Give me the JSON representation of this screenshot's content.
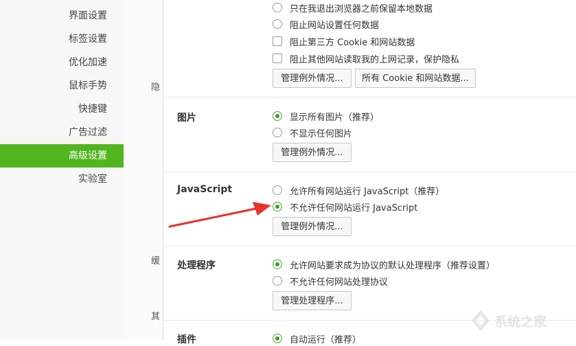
{
  "sidebar": {
    "items": [
      {
        "label": "界面设置"
      },
      {
        "label": "标签设置"
      },
      {
        "label": "优化加速"
      },
      {
        "label": "鼠标手势"
      },
      {
        "label": "快捷键"
      },
      {
        "label": "广告过滤"
      },
      {
        "label": "高级设置",
        "active": true
      },
      {
        "label": "实验室"
      }
    ]
  },
  "middle": {
    "cut_labels": [
      "隐",
      "缓",
      "其"
    ]
  },
  "privacy": {
    "options": [
      {
        "label": "只在我退出浏览器之前保留本地数据",
        "type": "radio",
        "checked": false
      },
      {
        "label": "阻止网站设置任何数据",
        "type": "radio",
        "checked": false
      },
      {
        "label": "阻止第三方 Cookie 和网站数据",
        "type": "checkbox",
        "checked": false
      },
      {
        "label": "阻止其他网站读取我的上网记录，保护隐私",
        "type": "checkbox",
        "checked": false
      }
    ],
    "buttons": [
      "管理例外情况...",
      "所有 Cookie 和网站数据..."
    ]
  },
  "images": {
    "title": "图片",
    "options": [
      {
        "label": "显示所有图片（推荐）",
        "checked": true
      },
      {
        "label": "不显示任何图片",
        "checked": false
      }
    ],
    "button": "管理例外情况..."
  },
  "javascript": {
    "title": "JavaScript",
    "options": [
      {
        "label": "允许所有网站运行 JavaScript（推荐）",
        "checked": false
      },
      {
        "label": "不允许任何网站运行 JavaScript",
        "checked": true
      }
    ],
    "button": "管理例外情况..."
  },
  "handlers": {
    "title": "处理程序",
    "options": [
      {
        "label": "允许网站要求成为协议的默认处理程序（推荐设置）",
        "checked": true
      },
      {
        "label": "不允许任何网站处理协议",
        "checked": false
      }
    ],
    "button": "管理处理程序..."
  },
  "plugins": {
    "title": "插件",
    "options": [
      {
        "label": "自动运行（推荐）",
        "checked": true
      }
    ]
  },
  "colors": {
    "accent": "#52b51f",
    "radio_dot": "#3aa126",
    "arrow": "#e8322c"
  },
  "watermark": {
    "text": "系统之家"
  }
}
